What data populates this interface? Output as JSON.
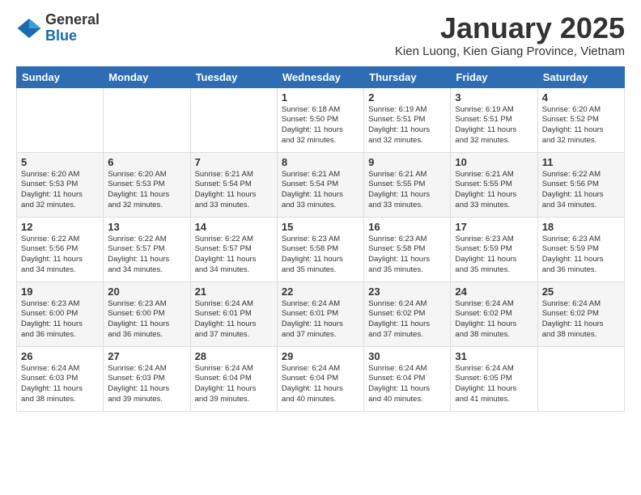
{
  "logo": {
    "general": "General",
    "blue": "Blue"
  },
  "header": {
    "title": "January 2025",
    "subtitle": "Kien Luong, Kien Giang Province, Vietnam"
  },
  "days_of_week": [
    "Sunday",
    "Monday",
    "Tuesday",
    "Wednesday",
    "Thursday",
    "Friday",
    "Saturday"
  ],
  "weeks": [
    [
      {
        "day": "",
        "info": ""
      },
      {
        "day": "",
        "info": ""
      },
      {
        "day": "",
        "info": ""
      },
      {
        "day": "1",
        "info": "Sunrise: 6:18 AM\nSunset: 5:50 PM\nDaylight: 11 hours\nand 32 minutes."
      },
      {
        "day": "2",
        "info": "Sunrise: 6:19 AM\nSunset: 5:51 PM\nDaylight: 11 hours\nand 32 minutes."
      },
      {
        "day": "3",
        "info": "Sunrise: 6:19 AM\nSunset: 5:51 PM\nDaylight: 11 hours\nand 32 minutes."
      },
      {
        "day": "4",
        "info": "Sunrise: 6:20 AM\nSunset: 5:52 PM\nDaylight: 11 hours\nand 32 minutes."
      }
    ],
    [
      {
        "day": "5",
        "info": "Sunrise: 6:20 AM\nSunset: 5:53 PM\nDaylight: 11 hours\nand 32 minutes."
      },
      {
        "day": "6",
        "info": "Sunrise: 6:20 AM\nSunset: 5:53 PM\nDaylight: 11 hours\nand 32 minutes."
      },
      {
        "day": "7",
        "info": "Sunrise: 6:21 AM\nSunset: 5:54 PM\nDaylight: 11 hours\nand 33 minutes."
      },
      {
        "day": "8",
        "info": "Sunrise: 6:21 AM\nSunset: 5:54 PM\nDaylight: 11 hours\nand 33 minutes."
      },
      {
        "day": "9",
        "info": "Sunrise: 6:21 AM\nSunset: 5:55 PM\nDaylight: 11 hours\nand 33 minutes."
      },
      {
        "day": "10",
        "info": "Sunrise: 6:21 AM\nSunset: 5:55 PM\nDaylight: 11 hours\nand 33 minutes."
      },
      {
        "day": "11",
        "info": "Sunrise: 6:22 AM\nSunset: 5:56 PM\nDaylight: 11 hours\nand 34 minutes."
      }
    ],
    [
      {
        "day": "12",
        "info": "Sunrise: 6:22 AM\nSunset: 5:56 PM\nDaylight: 11 hours\nand 34 minutes."
      },
      {
        "day": "13",
        "info": "Sunrise: 6:22 AM\nSunset: 5:57 PM\nDaylight: 11 hours\nand 34 minutes."
      },
      {
        "day": "14",
        "info": "Sunrise: 6:22 AM\nSunset: 5:57 PM\nDaylight: 11 hours\nand 34 minutes."
      },
      {
        "day": "15",
        "info": "Sunrise: 6:23 AM\nSunset: 5:58 PM\nDaylight: 11 hours\nand 35 minutes."
      },
      {
        "day": "16",
        "info": "Sunrise: 6:23 AM\nSunset: 5:58 PM\nDaylight: 11 hours\nand 35 minutes."
      },
      {
        "day": "17",
        "info": "Sunrise: 6:23 AM\nSunset: 5:59 PM\nDaylight: 11 hours\nand 35 minutes."
      },
      {
        "day": "18",
        "info": "Sunrise: 6:23 AM\nSunset: 5:59 PM\nDaylight: 11 hours\nand 36 minutes."
      }
    ],
    [
      {
        "day": "19",
        "info": "Sunrise: 6:23 AM\nSunset: 6:00 PM\nDaylight: 11 hours\nand 36 minutes."
      },
      {
        "day": "20",
        "info": "Sunrise: 6:23 AM\nSunset: 6:00 PM\nDaylight: 11 hours\nand 36 minutes."
      },
      {
        "day": "21",
        "info": "Sunrise: 6:24 AM\nSunset: 6:01 PM\nDaylight: 11 hours\nand 37 minutes."
      },
      {
        "day": "22",
        "info": "Sunrise: 6:24 AM\nSunset: 6:01 PM\nDaylight: 11 hours\nand 37 minutes."
      },
      {
        "day": "23",
        "info": "Sunrise: 6:24 AM\nSunset: 6:02 PM\nDaylight: 11 hours\nand 37 minutes."
      },
      {
        "day": "24",
        "info": "Sunrise: 6:24 AM\nSunset: 6:02 PM\nDaylight: 11 hours\nand 38 minutes."
      },
      {
        "day": "25",
        "info": "Sunrise: 6:24 AM\nSunset: 6:02 PM\nDaylight: 11 hours\nand 38 minutes."
      }
    ],
    [
      {
        "day": "26",
        "info": "Sunrise: 6:24 AM\nSunset: 6:03 PM\nDaylight: 11 hours\nand 38 minutes."
      },
      {
        "day": "27",
        "info": "Sunrise: 6:24 AM\nSunset: 6:03 PM\nDaylight: 11 hours\nand 39 minutes."
      },
      {
        "day": "28",
        "info": "Sunrise: 6:24 AM\nSunset: 6:04 PM\nDaylight: 11 hours\nand 39 minutes."
      },
      {
        "day": "29",
        "info": "Sunrise: 6:24 AM\nSunset: 6:04 PM\nDaylight: 11 hours\nand 40 minutes."
      },
      {
        "day": "30",
        "info": "Sunrise: 6:24 AM\nSunset: 6:04 PM\nDaylight: 11 hours\nand 40 minutes."
      },
      {
        "day": "31",
        "info": "Sunrise: 6:24 AM\nSunset: 6:05 PM\nDaylight: 11 hours\nand 41 minutes."
      },
      {
        "day": "",
        "info": ""
      }
    ]
  ]
}
